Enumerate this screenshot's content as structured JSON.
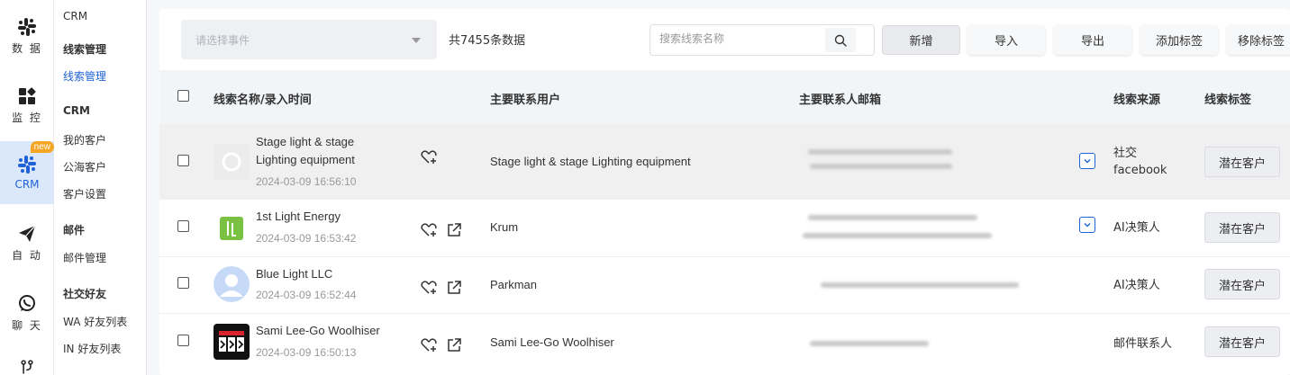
{
  "rail": {
    "items": [
      {
        "label": "数 据",
        "icon": "slack-icon"
      },
      {
        "label": "监 控",
        "icon": "dashboard-icon"
      },
      {
        "label": "CRM",
        "icon": "slack-icon",
        "badge": "new"
      },
      {
        "label": "自 动",
        "icon": "paper-plane-icon"
      },
      {
        "label": "聊 天",
        "icon": "whatsapp-icon"
      }
    ]
  },
  "menu": {
    "crm": "CRM",
    "lead_group": "线索管理",
    "lead_item": "线索管理",
    "crm_group": "CRM",
    "my_customers": "我的客户",
    "public_customers": "公海客户",
    "customer_settings": "客户设置",
    "mail_group": "邮件",
    "mail_manage": "邮件管理",
    "social_group": "社交好友",
    "wa_list": "WA 好友列表",
    "in_list": "IN 好友列表"
  },
  "toolbar": {
    "event_placeholder": "请选择事件",
    "total": "共7455条数据",
    "search_placeholder": "搜索线索名称",
    "new": "新增",
    "import": "导入",
    "export": "导出",
    "add_tag": "添加标签",
    "remove_tag": "移除标签"
  },
  "table": {
    "headers": {
      "name": "线索名称/录入时间",
      "contact": "主要联系用户",
      "email": "主要联系人邮箱",
      "source": "线索来源",
      "tag": "线索标签"
    },
    "rows": [
      {
        "name_line1": "Stage light & stage",
        "name_line2": "Lighting equipment",
        "time": "2024-03-09 16:56:10",
        "contact": "Stage light & stage Lighting equipment",
        "source_line1": "社交",
        "source_line2": "facebook",
        "tag": "潜在客户"
      },
      {
        "name_line1": "1st Light Energy",
        "time": "2024-03-09 16:53:42",
        "contact": "Krum",
        "source_line1": "AI决策人",
        "tag": "潜在客户"
      },
      {
        "name_line1": "Blue Light LLC",
        "time": "2024-03-09 16:52:44",
        "contact": "Parkman",
        "source_line1": "AI决策人",
        "tag": "潜在客户"
      },
      {
        "name_line1": "Sami Lee-Go Woolhiser",
        "time": "2024-03-09 16:50:13",
        "contact": "Sami Lee-Go Woolhiser",
        "source_line1": "邮件联系人",
        "tag": "潜在客户"
      }
    ]
  },
  "colors": {
    "accent": "#1e62d6",
    "badge": "#f5a623",
    "header_bg": "#f2f5f8",
    "row_highlight": "#f0f0f0"
  }
}
